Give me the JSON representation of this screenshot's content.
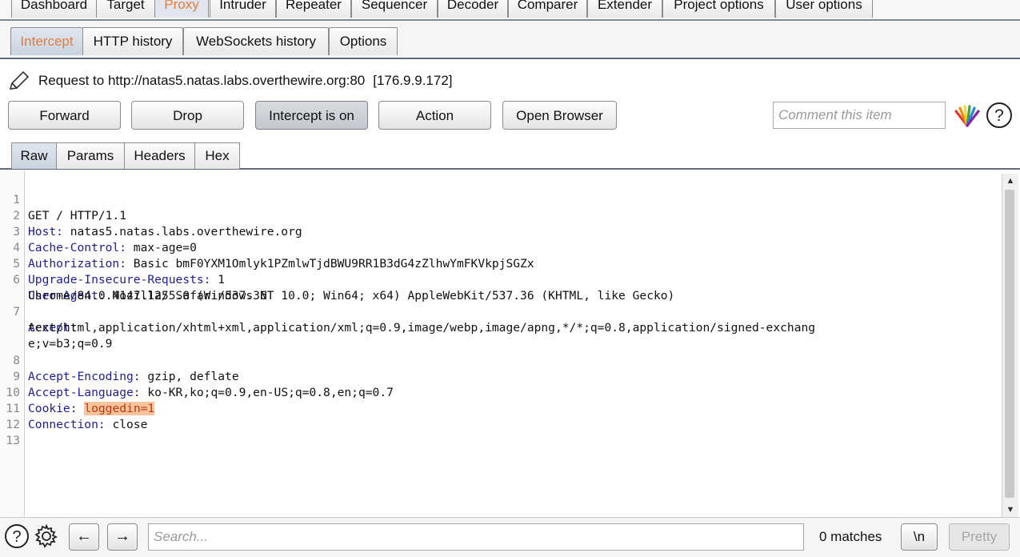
{
  "main_tabs": [
    "Dashboard",
    "Target",
    "Proxy",
    "Intruder",
    "Repeater",
    "Sequencer",
    "Decoder",
    "Comparer",
    "Extender",
    "Project options",
    "User options"
  ],
  "sub_tabs": [
    "Intercept",
    "HTTP history",
    "WebSockets history",
    "Options"
  ],
  "request": {
    "label": "Request to http://natas5.natas.labs.overthewire.org:80",
    "ip": "[176.9.9.172]"
  },
  "buttons": {
    "forward": "Forward",
    "drop": "Drop",
    "intercept": "Intercept is on",
    "action": "Action",
    "open_browser": "Open Browser"
  },
  "comment": {
    "placeholder": "Comment this item"
  },
  "view_tabs": [
    "Raw",
    "Params",
    "Headers",
    "Hex"
  ],
  "editor": {
    "line_numbers": [
      "1",
      "2",
      "3",
      "4",
      "5",
      "6",
      "7",
      "8",
      "9",
      "10",
      "11",
      "12",
      "13"
    ],
    "lines": [
      {
        "name": "",
        "value": "GET / HTTP/1.1"
      },
      {
        "name": "Host:",
        "value": " natas5.natas.labs.overthewire.org"
      },
      {
        "name": "Cache-Control:",
        "value": " max-age=0"
      },
      {
        "name": "Authorization:",
        "value": " Basic bmF0YXM1Omlyk1PZmlwTjdBWU9RR1B3dG4zZlhwYmFKVkpjSGZx"
      },
      {
        "name": "Upgrade-Insecure-Requests:",
        "value": " 1"
      },
      {
        "name": "User-Agent:",
        "value": " Mozilla/5.0 (Windows NT 10.0; Win64; x64) AppleWebKit/537.36 (KHTML, like Gecko)"
      },
      {
        "name": "",
        "value": "Chrome/84.0.4147.125 Safari/537.36"
      },
      {
        "name": "Accept:",
        "value": ""
      },
      {
        "name": "",
        "value": "text/html,application/xhtml+xml,application/xml;q=0.9,image/webp,image/apng,*/*;q=0.8,application/signed-exchang"
      },
      {
        "name": "",
        "value": "e;v=b3;q=0.9"
      },
      {
        "name": "Accept-Encoding:",
        "value": " gzip, deflate"
      },
      {
        "name": "Accept-Language:",
        "value": " ko-KR,ko;q=0.9,en-US;q=0.8,en;q=0.7"
      },
      {
        "name": "Cookie:",
        "value": " ",
        "highlight": "loggedin=1"
      },
      {
        "name": "Connection:",
        "value": " close"
      }
    ]
  },
  "bottom": {
    "search_placeholder": "Search...",
    "matches": "0 matches",
    "newline_label": "\\n",
    "pretty_label": "Pretty",
    "back_glyph": "←",
    "forward_glyph": "→"
  },
  "colors": {
    "active_tab_text": "#e87b3a",
    "header_name": "#1d1d9a",
    "highlight_bg": "#f9c39b",
    "highlight_text": "#c0390f"
  },
  "icons": [
    "pencil-icon",
    "burp-logo-icon",
    "help-icon",
    "gear-icon",
    "arrow-left-icon",
    "arrow-right-icon"
  ]
}
